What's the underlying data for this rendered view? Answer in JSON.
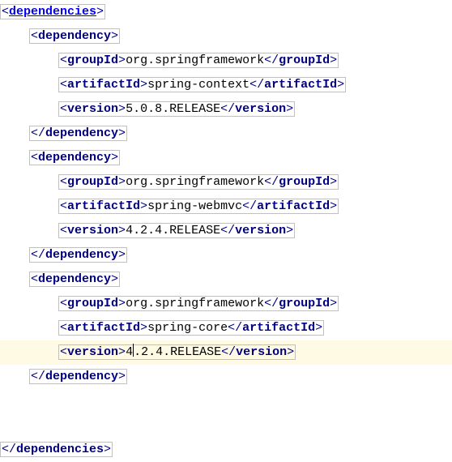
{
  "root": {
    "open": "dependencies",
    "close": "dependencies"
  },
  "deps": [
    {
      "open": "dependency",
      "close": "dependency",
      "groupId": {
        "tag": "groupId",
        "val": "org.springframework"
      },
      "artifactId": {
        "tag": "artifactId",
        "val": "spring-context"
      },
      "version": {
        "tag": "version",
        "val": "5.0.8.RELEASE"
      }
    },
    {
      "open": "dependency",
      "close": "dependency",
      "groupId": {
        "tag": "groupId",
        "val": "org.springframework"
      },
      "artifactId": {
        "tag": "artifactId",
        "val": "spring-webmvc"
      },
      "version": {
        "tag": "version",
        "val": "4.2.4.RELEASE"
      }
    },
    {
      "open": "dependency",
      "close": "dependency",
      "groupId": {
        "tag": "groupId",
        "val": "org.springframework"
      },
      "artifactId": {
        "tag": "artifactId",
        "val": "spring-core"
      },
      "version": {
        "tag": "version",
        "before": "4",
        "after": ".2.4.RELEASE"
      }
    }
  ]
}
